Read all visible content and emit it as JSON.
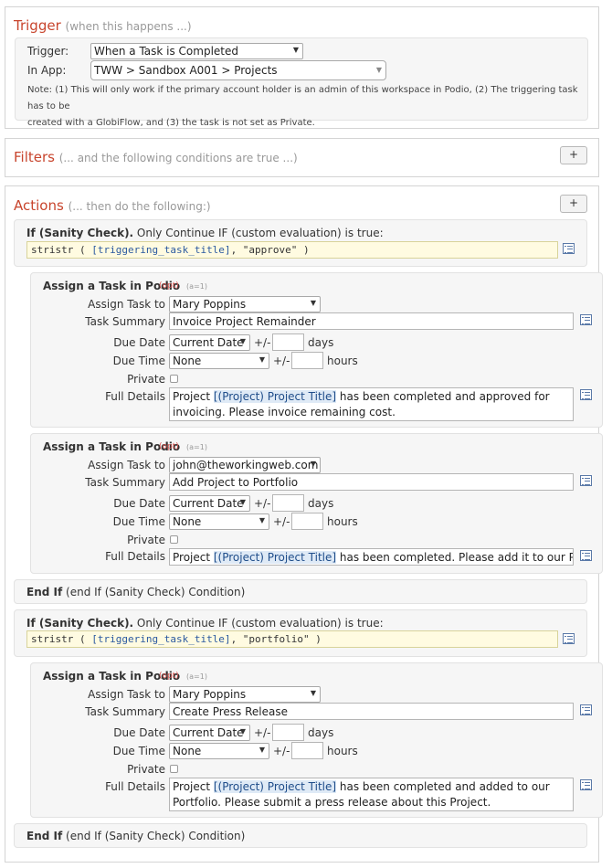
{
  "trigger": {
    "heading": "Trigger",
    "heading_sub": "(when this happens ...)",
    "trigger_label": "Trigger:",
    "trigger_value": "When a Task is Completed",
    "app_label": "In App:",
    "app_value": "TWW > Sandbox A001 > Projects",
    "note_line1": "Note: (1) This will only work if the primary account holder is an admin of this workspace in Podio, (2) The triggering task has to be",
    "note_line2": "created with a GlobiFlow, and (3) the task is not set as Private."
  },
  "filters": {
    "heading": "Filters",
    "heading_sub": "(... and the following conditions are true ...)",
    "add_label": "+"
  },
  "actions": {
    "heading": "Actions",
    "heading_sub": "(... then do the following:)",
    "add_label": "+",
    "labels": {
      "assign_to": "Assign Task to",
      "summary": "Task Summary",
      "due_date": "Due Date",
      "due_time": "Due Time",
      "private": "Private",
      "details": "Full Details",
      "plusminus": "+/-",
      "days": "days",
      "hours": "hours",
      "opt": "(opt)",
      "count": "(a=1)"
    },
    "check1": {
      "title_bold": "If (Sanity Check).",
      "title_rest": " Only Continue IF (custom evaluation) is true:",
      "code_pre": "stristr ( ",
      "code_token": "[triggering_task_title]",
      "code_post": ", \"approve\" )"
    },
    "task1": {
      "title": "Assign a Task in Podio",
      "assign_to": "Mary Poppins",
      "summary": "Invoice Project Remainder",
      "due_date": "Current Date",
      "due_time": "None",
      "details_pre": "Project ",
      "details_token": "[(Project) Project Title]",
      "details_post": " has been completed and approved for invoicing. Please invoice remaining cost."
    },
    "task2": {
      "title": "Assign a Task in Podio",
      "assign_to": "john@theworkingweb.com",
      "summary": "Add Project to Portfolio",
      "due_date": "Current Date",
      "due_time": "None",
      "details_pre": "Project ",
      "details_token": "[(Project) Project Title]",
      "details_post": " has been completed. Please add it to our Portfolio."
    },
    "endif1": {
      "bold": "End If",
      "rest": " (end If (Sanity Check) Condition)"
    },
    "check2": {
      "title_bold": "If (Sanity Check).",
      "title_rest": " Only Continue IF (custom evaluation) is true:",
      "code_pre": "stristr ( ",
      "code_token": "[triggering_task_title]",
      "code_post": ", \"portfolio\" )"
    },
    "task3": {
      "title": "Assign a Task in Podio",
      "assign_to": "Mary Poppins",
      "summary": "Create Press Release",
      "due_date": "Current Date",
      "due_time": "None",
      "details_pre": "Project ",
      "details_token": "[(Project) Project Title]",
      "details_post": " has been completed and added to our Portfolio. Please submit a press release about this Project."
    },
    "endif2": {
      "bold": "End If",
      "rest": " (end If (Sanity Check) Condition)"
    }
  },
  "icons": {
    "dropdown": "chevron-down-icon",
    "field_picker": "field-list-icon"
  }
}
